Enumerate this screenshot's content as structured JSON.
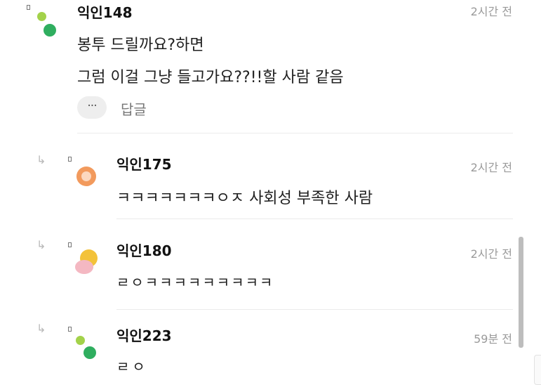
{
  "comments": [
    {
      "name": "익인148",
      "time": "2시간 전",
      "lines": [
        "봉투 드릴까요?하면",
        "그럼 이걸 그냥 들고가요??!!할 사람 같음"
      ],
      "more_label": "···",
      "reply_label": "답글"
    },
    {
      "name": "익인175",
      "time": "2시간 전",
      "lines": [
        "ㅋㅋㅋㅋㅋㅋㅋㅇㅈ 사회성 부족한 사람"
      ]
    },
    {
      "name": "익인180",
      "time": "2시간 전",
      "lines": [
        "ㄹㅇㅋㅋㅋㅋㅋㅋㅋㅋㅋ"
      ]
    },
    {
      "name": "익인223",
      "time": "59분 전",
      "lines": [
        "ㄹㅇ"
      ]
    }
  ],
  "icons": {
    "reply_arrow": "reply-arrow-icon",
    "author_marker": "author-marker-icon"
  },
  "colors": {
    "green_light": "#a3d24a",
    "green_dark": "#2fae5f",
    "orange": "#f29a5d",
    "yellow": "#f3c23a",
    "pink": "#f4b8c2",
    "meta_gray": "#9a9a9a"
  }
}
